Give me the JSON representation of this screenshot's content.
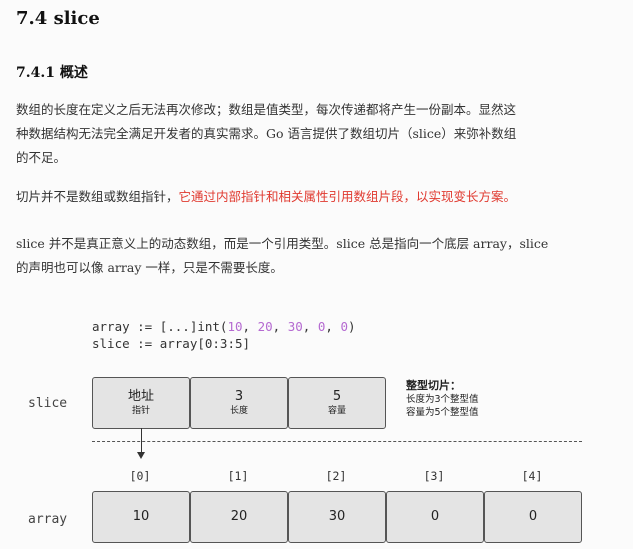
{
  "heading": "7.4 slice",
  "subheading": "7.4.1 概述",
  "paragraphs": {
    "p1_line1": "数组的长度在定义之后无法再次修改；数组是值类型，每次传递都将产生一份副本。显然这",
    "p1_line2": "种数据结构无法完全满足开发者的真实需求。Go 语言提供了数组切片（slice）来弥补数组",
    "p1_line3": "的不足。",
    "p2_plain": "切片并不是数组或数组指针，",
    "p2_red": "它通过内部指针和相关属性引用数组片段，以实现变长方案。",
    "p3_line1": "slice 并不是真正意义上的动态数组，而是一个引用类型。slice 总是指向一个底层 array，slice",
    "p3_line2": "的声明也可以像 array 一样，只是不需要长度。"
  },
  "code": {
    "line1_prefix": "array := [...]int(",
    "line1_nums": [
      "10",
      "20",
      "30",
      "0",
      "0"
    ],
    "line1_suffix": ")",
    "line2": "slice := array[0:3:5]"
  },
  "diagram": {
    "slice_label": "slice",
    "array_label": "array",
    "slice_boxes": [
      {
        "main": "地址",
        "sub": "指针"
      },
      {
        "main": "3",
        "sub": "长度"
      },
      {
        "main": "5",
        "sub": "容量"
      }
    ],
    "note_title": "整型切片：",
    "note_line1": "长度为3个整型值",
    "note_line2": "容量为5个整型值",
    "indices": [
      "[0]",
      "[1]",
      "[2]",
      "[3]",
      "[4]"
    ],
    "array_values": [
      "10",
      "20",
      "30",
      "0",
      "0"
    ]
  },
  "colors": {
    "highlight": "#e0392f",
    "code_number": "#b56ad1",
    "box_fill": "#e4e4e4"
  }
}
